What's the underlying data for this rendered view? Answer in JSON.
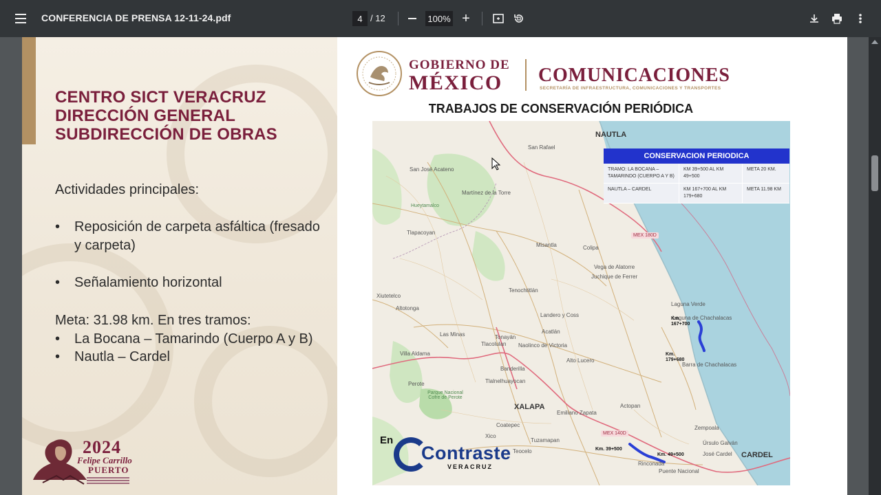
{
  "toolbar": {
    "title": "CONFERENCIA DE PRENSA 12-11-24.pdf",
    "current_page": "4",
    "page_total": "/ 12",
    "zoom": "100%",
    "zoom_in": "+",
    "icons": [
      "menu-icon",
      "zoom-out-icon",
      "zoom-in-icon",
      "fit-page-icon",
      "rotate-icon",
      "download-icon",
      "print-icon",
      "more-vert-icon"
    ]
  },
  "slide": {
    "heading": [
      "CENTRO SICT VERACRUZ",
      "DIRECCIÓN GENERAL",
      "SUBDIRECCIÓN DE OBRAS"
    ],
    "activities_label": "Actividades principales:",
    "bullets": [
      "Reposición de carpeta asfáltica (fresado y carpeta)",
      "Señalamiento horizontal"
    ],
    "goal": "Meta: 31.98 km. En tres tramos:",
    "segments": [
      "La Bocana – Tamarindo (Cuerpo A y B)",
      "Nautla – Cardel"
    ],
    "bullet_char": "•",
    "logo_2024": {
      "year": "2024",
      "name": "Felipe Carrillo",
      "surname": "PUERTO"
    },
    "gob_line1": "GOBIERNO DE",
    "gob_line2": "MÉXICO",
    "comunicaciones": "COMUNICACIONES",
    "comunicaciones_sub": "SECRETARÍA DE INFRAESTRUCTURA, COMUNICACIONES Y TRANSPORTES",
    "map_title": "TRABAJOS DE CONSERVACIÓN PERIÓDICA",
    "table": {
      "header": "CONSERVACION PERIODICA",
      "rows": [
        [
          "TRAMO: LA BOCANA – TAMARINDO (CUERPO A Y B)",
          "KM 39+500 AL KM 49+500",
          "META 20 KM."
        ],
        [
          "NAUTLA – CARDEL",
          "KM 167+700 AL KM 179+680",
          "META 11.98 KM"
        ]
      ]
    },
    "map_labels": {
      "nautla": "NAUTLA",
      "xalapa": "XALAPA",
      "cardel": "CARDEL",
      "mex180d": "MEX 180D",
      "mex140d": "MEX 140D",
      "km167": "Km.\n167+700",
      "km179": "Km.\n179+680",
      "km39": "Km. 39+500",
      "km49": "Km. 49+500",
      "towns": [
        "San Rafael",
        "San José Acateno",
        "Martínez de la Torre",
        "Tlapacoyan",
        "Hueytamalco",
        "Misantla",
        "Colipa",
        "Tenochtitlán",
        "Landero y Coss",
        "Acatlán",
        "Tonayán",
        "Naolinco de Victoria",
        "Alto Lucero",
        "Tlacolulan",
        "Las Minas",
        "Villa Aldama",
        "Perote",
        "Banderilla",
        "Tlalnelhuayocan",
        "Coatepec",
        "Xico",
        "Tuzamapan",
        "Teocelo",
        "Emiliano Zapata",
        "Actopan",
        "Zempoala",
        "Úrsulo Galván",
        "José Cardel",
        "Puente Nacional",
        "Rinconada",
        "Xiutetelco",
        "Altotonga",
        "Vega de Alatorre",
        "Juchique de Ferrer",
        "Laguna Verde",
        "Laguna de Chachalacas",
        "Barra de Chachalacas",
        "Villa Aldama"
      ],
      "park": "Parque Nacional Cofre de Perote"
    },
    "watermark": {
      "prefix": "En",
      "name": "Contraste",
      "sub": "VERACRUZ"
    }
  },
  "colors": {
    "toolbar_bg": "#323639",
    "viewer_bg": "#525659",
    "guinda": "#7a1f3c",
    "gold": "#b39163",
    "table_head": "#2233cc",
    "route_blue": "#2a3fd6"
  }
}
